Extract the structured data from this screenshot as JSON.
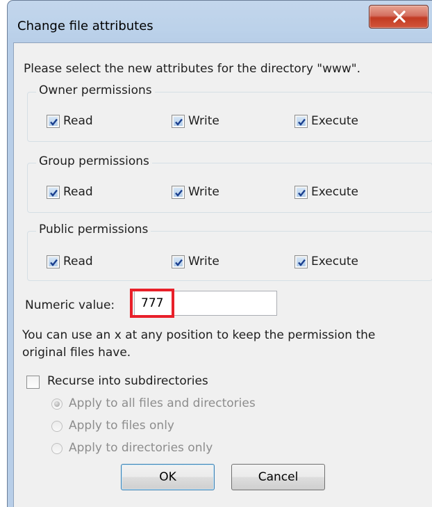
{
  "window": {
    "title": "Change file attributes",
    "close_glyph": "X"
  },
  "intro": "Please select the new attributes for the directory \"www\".",
  "groups": [
    {
      "label": "Owner permissions",
      "items": [
        {
          "label": "Read",
          "checked": true
        },
        {
          "label": "Write",
          "checked": true
        },
        {
          "label": "Execute",
          "checked": true
        }
      ]
    },
    {
      "label": "Group permissions",
      "items": [
        {
          "label": "Read",
          "checked": true
        },
        {
          "label": "Write",
          "checked": true
        },
        {
          "label": "Execute",
          "checked": true
        }
      ]
    },
    {
      "label": "Public permissions",
      "items": [
        {
          "label": "Read",
          "checked": true
        },
        {
          "label": "Write",
          "checked": true
        },
        {
          "label": "Execute",
          "checked": true
        }
      ]
    }
  ],
  "numeric": {
    "label": "Numeric value:",
    "value": "777",
    "highlight_color": "#e8202a"
  },
  "hint_line1": "You can use an x at any position to keep the permission the",
  "hint_line2": "original files have.",
  "recurse": {
    "label": "Recurse into subdirectories",
    "checked": false
  },
  "apply_options": [
    {
      "label": "Apply to all files and directories",
      "selected": true,
      "enabled": false
    },
    {
      "label": "Apply to files only",
      "selected": false,
      "enabled": false
    },
    {
      "label": "Apply to directories only",
      "selected": false,
      "enabled": false
    }
  ],
  "buttons": {
    "ok": "OK",
    "cancel": "Cancel"
  },
  "colors": {
    "check": "#1a3f8f",
    "disabled_text": "#8d8d8d",
    "close_button": "#c23a22"
  }
}
